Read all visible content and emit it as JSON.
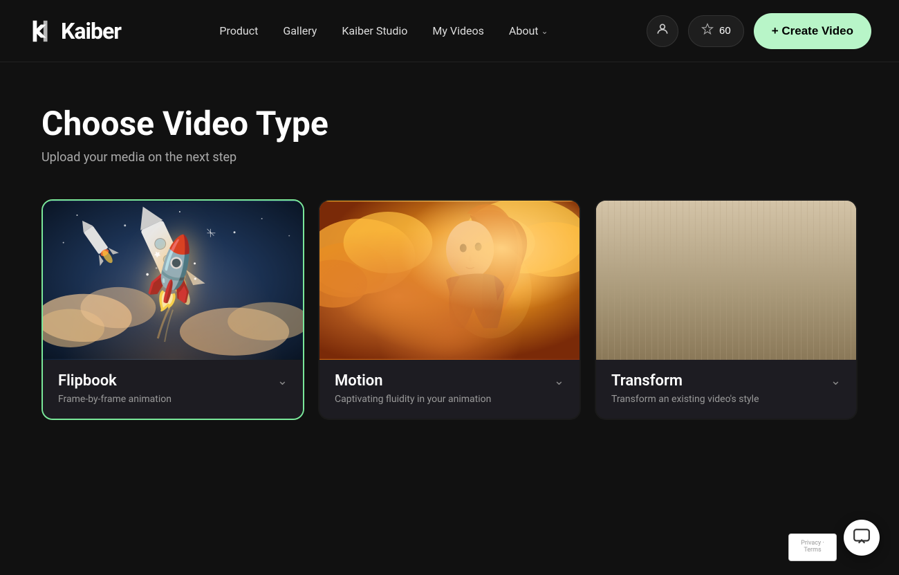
{
  "header": {
    "logo_text": "Kaiber",
    "nav": [
      {
        "label": "Product",
        "has_dropdown": false
      },
      {
        "label": "Gallery",
        "has_dropdown": false
      },
      {
        "label": "Kaiber Studio",
        "has_dropdown": false
      },
      {
        "label": "My Videos",
        "has_dropdown": false
      },
      {
        "label": "About",
        "has_dropdown": true
      }
    ],
    "credits_count": "60",
    "create_button_label": "+ Create Video"
  },
  "main": {
    "title": "Choose Video Type",
    "subtitle": "Upload your media on the next step",
    "cards": [
      {
        "id": "flipbook",
        "title": "Flipbook",
        "description": "Frame-by-frame animation",
        "selected": true
      },
      {
        "id": "motion",
        "title": "Motion",
        "description": "Captivating fluidity in your animation",
        "selected": false
      },
      {
        "id": "transform",
        "title": "Transform",
        "description": "Transform an existing video's style",
        "selected": false
      }
    ]
  },
  "icons": {
    "user": "👤",
    "credits": "⬡",
    "chevron_down": "∨",
    "chevron_card": "∨",
    "chat": "□",
    "plus": "+"
  },
  "colors": {
    "selected_border": "#7ae89a",
    "create_btn_bg": "#b8f5c8",
    "background": "#111111",
    "card_bg": "#1a1a1a"
  }
}
